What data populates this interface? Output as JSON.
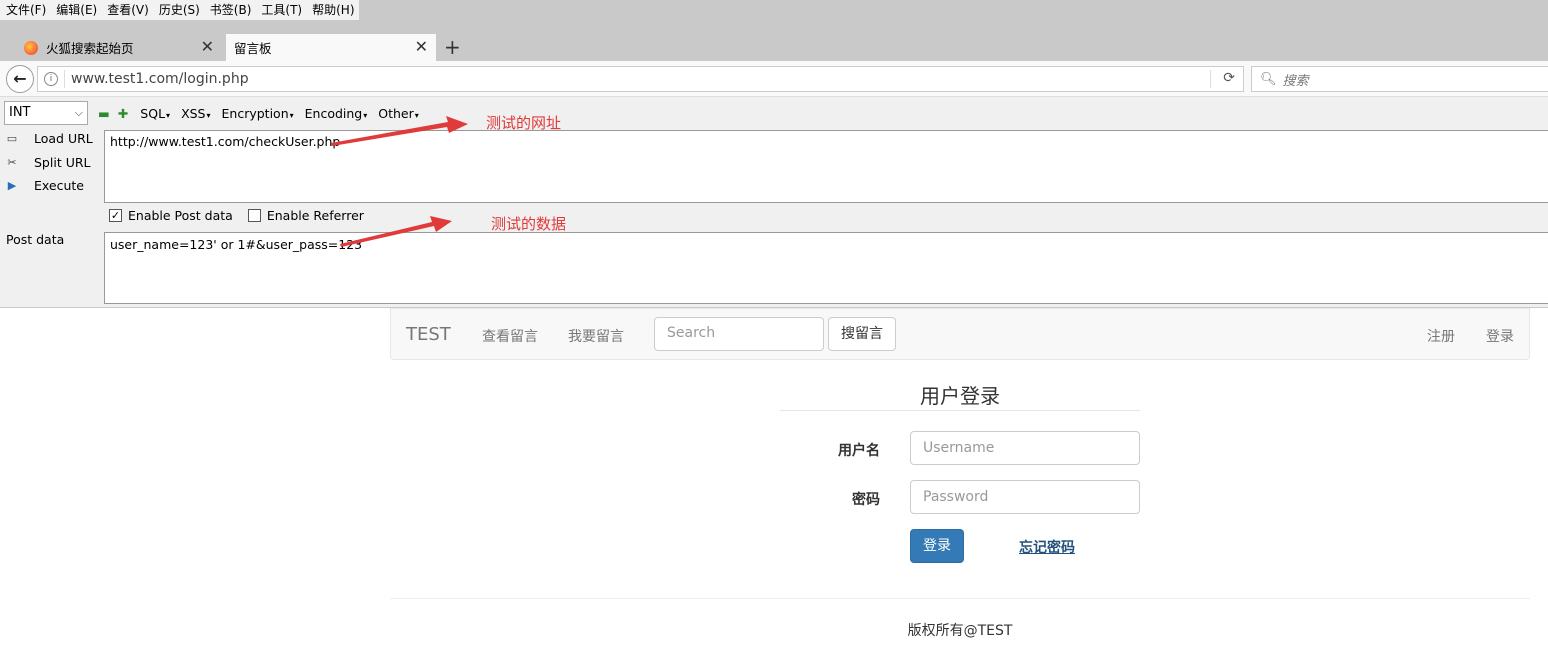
{
  "menubar": {
    "items": [
      "文件(F)",
      "编辑(E)",
      "查看(V)",
      "历史(S)",
      "书签(B)",
      "工具(T)",
      "帮助(H)"
    ]
  },
  "tabs": [
    {
      "title": "火狐搜索起始页",
      "icon": "firefox-icon",
      "active": false
    },
    {
      "title": "留言板",
      "active": true
    }
  ],
  "navbar": {
    "url": "www.test1.com/login.php",
    "search_placeholder": "搜索"
  },
  "hackbar": {
    "type_select": "INT",
    "menus": [
      "SQL",
      "XSS",
      "Encryption",
      "Encoding",
      "Other"
    ],
    "commands": [
      "Load URL",
      "Split URL",
      "Execute"
    ],
    "url_value": "http://www.test1.com/checkUser.php",
    "enable_post_label": "Enable Post data",
    "enable_post_checked": true,
    "enable_referrer_label": "Enable Referrer",
    "enable_referrer_checked": false,
    "post_label": "Post data",
    "post_value": "user_name=123' or 1#&user_pass=123"
  },
  "annotations": {
    "url_note": "测试的网址",
    "data_note": "测试的数据",
    "color": "#e03a3a"
  },
  "site": {
    "brand": "TEST",
    "nav_links": [
      "查看留言",
      "我要留言"
    ],
    "search_placeholder": "Search",
    "search_button": "搜留言",
    "right_links": [
      "注册",
      "登录"
    ],
    "login_title": "用户登录",
    "username_label": "用户名",
    "username_placeholder": "Username",
    "password_label": "密码",
    "password_placeholder": "Password",
    "login_button": "登录",
    "forgot_link": "忘记密码",
    "footer": "版权所有@TEST",
    "primary_color": "#337ab7"
  }
}
